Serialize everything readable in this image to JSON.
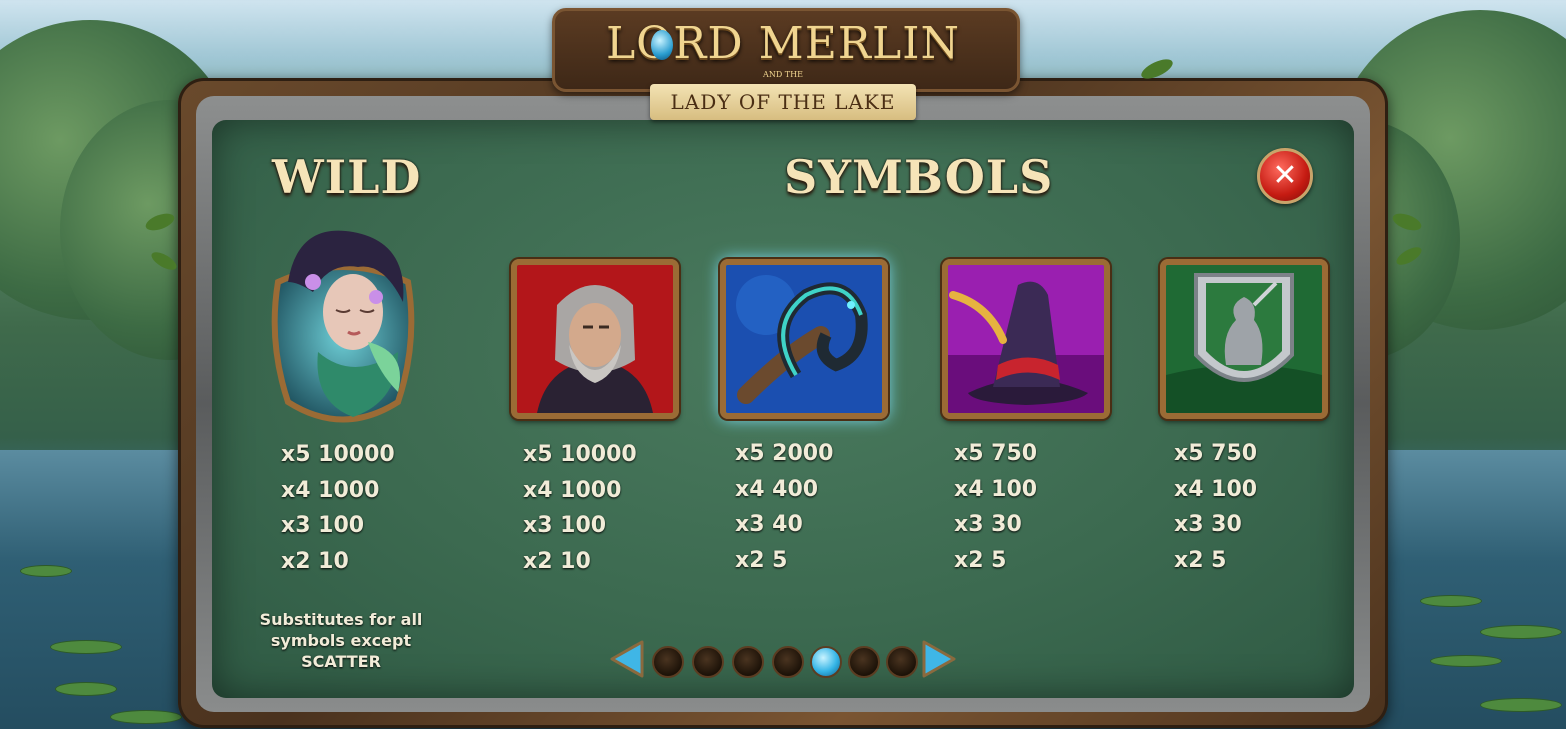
{
  "game": {
    "title": "LORD MERLIN",
    "title_joiner": "AND THE",
    "subtitle": "LADY OF THE LAKE"
  },
  "headings": {
    "wild": "WILD",
    "symbols": "SYMBOLS"
  },
  "close_button": {
    "icon": "close-icon",
    "color": "#c51b12"
  },
  "wild": {
    "symbol": "lady-of-the-lake",
    "payouts": [
      "x5 10000",
      "x4 1000",
      "x3 100",
      "x2 10"
    ],
    "description": [
      "Substitutes for all",
      "symbols except",
      "SCATTER"
    ]
  },
  "symbols": [
    {
      "name": "merlin",
      "payouts": [
        "x5 10000",
        "x4 1000",
        "x3 100",
        "x2 10"
      ]
    },
    {
      "name": "dragon",
      "payouts": [
        "x5 2000",
        "x4 400",
        "x3 40",
        "x2 5"
      ]
    },
    {
      "name": "wizard-hat",
      "payouts": [
        "x5 750",
        "x4 100",
        "x3 30",
        "x2 5"
      ]
    },
    {
      "name": "lion-shield",
      "payouts": [
        "x5 750",
        "x4 100",
        "x3 30",
        "x2 5"
      ]
    }
  ],
  "pagination": {
    "pages": 7,
    "current": 5,
    "prev_icon": "arrow-left-icon",
    "next_icon": "arrow-right-icon"
  }
}
